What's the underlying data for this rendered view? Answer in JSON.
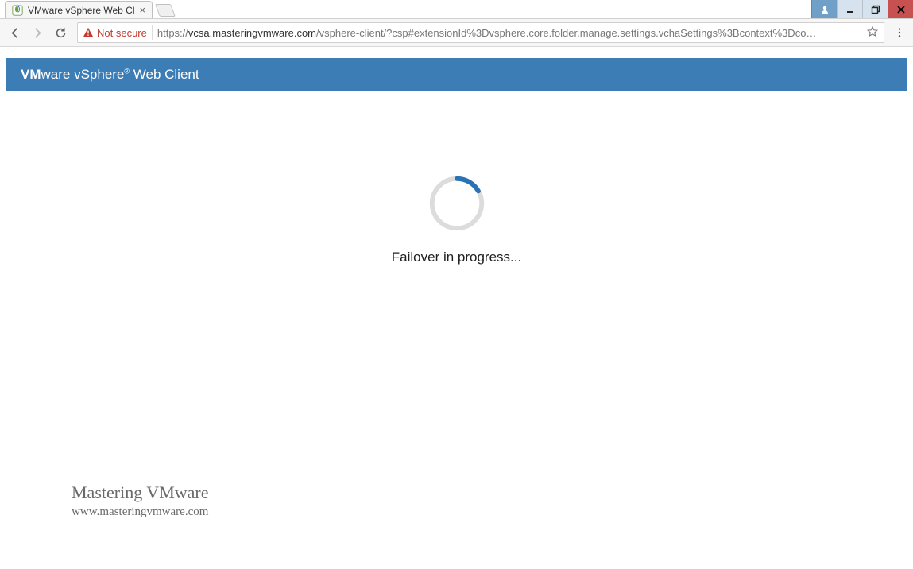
{
  "window": {
    "tab_title": "VMware vSphere Web Cl",
    "user_btn": "user",
    "min_btn": "minimize",
    "max_btn": "restore",
    "close_btn": "close"
  },
  "addressbar": {
    "security_label": "Not secure",
    "scheme": "https",
    "scheme_suffix": "://",
    "host": "vcsa.masteringvmware.com",
    "path": "/vsphere-client/?csp#extensionId%3Dvsphere.core.folder.manage.settings.vchaSettings%3Bcontext%3Dco…"
  },
  "app": {
    "banner_prefix": "VM",
    "banner_mid": "ware vSphere",
    "banner_reg": "®",
    "banner_suffix": " Web Client",
    "status_text": "Failover in progress..."
  },
  "watermark": {
    "title": "Mastering VMware",
    "url": "www.masteringvmware.com"
  }
}
